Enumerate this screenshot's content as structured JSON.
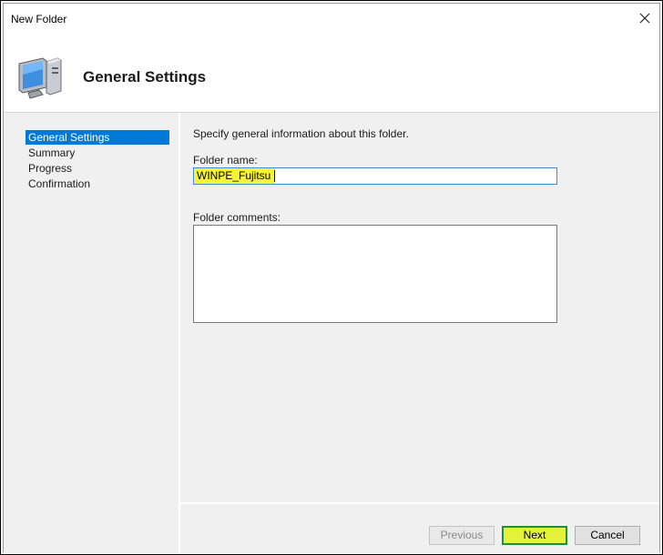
{
  "window": {
    "title": "New Folder",
    "header_title": "General Settings",
    "icon": "computer-monitor-icon",
    "close_icon": "close-icon"
  },
  "sidebar": {
    "items": [
      {
        "label": "General Settings",
        "active": true
      },
      {
        "label": "Summary",
        "active": false
      },
      {
        "label": "Progress",
        "active": false
      },
      {
        "label": "Confirmation",
        "active": false
      }
    ]
  },
  "main": {
    "instruction": "Specify general information about this folder.",
    "folder_name_label": "Folder name:",
    "folder_name_value": "WINPE_Fujitsu",
    "folder_comments_label": "Folder comments:",
    "folder_comments_value": ""
  },
  "footer": {
    "previous_label": "Previous",
    "next_label": "Next",
    "cancel_label": "Cancel"
  },
  "colors": {
    "selection": "#0078d7",
    "highlight": "#f7f33a",
    "next_border": "#1e8f3a"
  }
}
